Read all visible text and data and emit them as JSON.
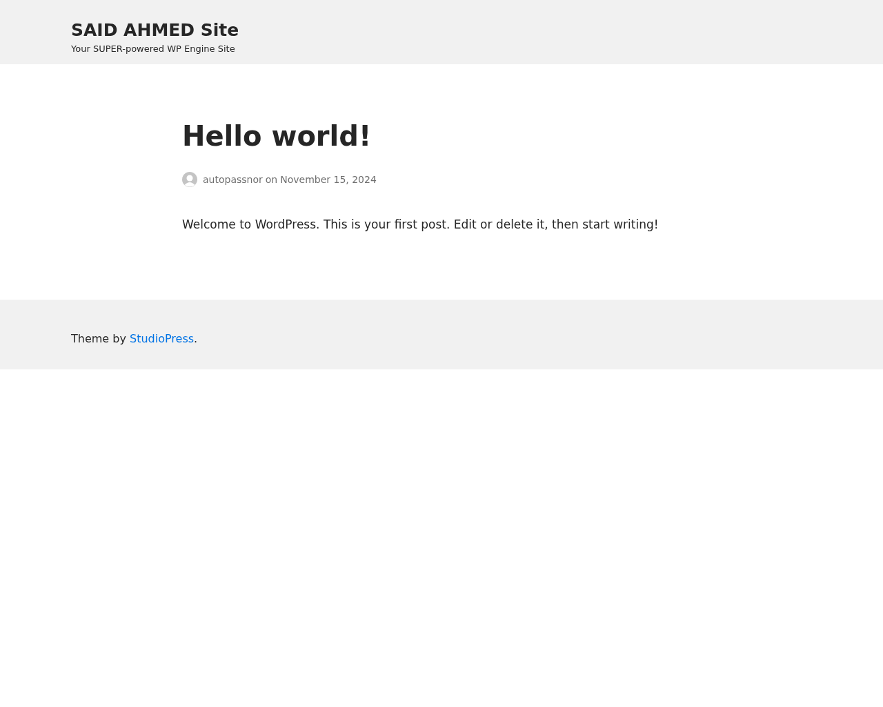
{
  "header": {
    "site_title": "SAID AHMED Site",
    "tagline": "Your SUPER-powered WP Engine Site"
  },
  "post": {
    "title": "Hello world!",
    "meta": {
      "author": "autopassnor",
      "joiner": "on",
      "date": "November 15, 2024"
    },
    "content": "Welcome to WordPress. This is your first post. Edit or delete it, then start writing!"
  },
  "footer": {
    "text_before": "Theme by",
    "link": "StudioPress",
    "text_after": "."
  }
}
